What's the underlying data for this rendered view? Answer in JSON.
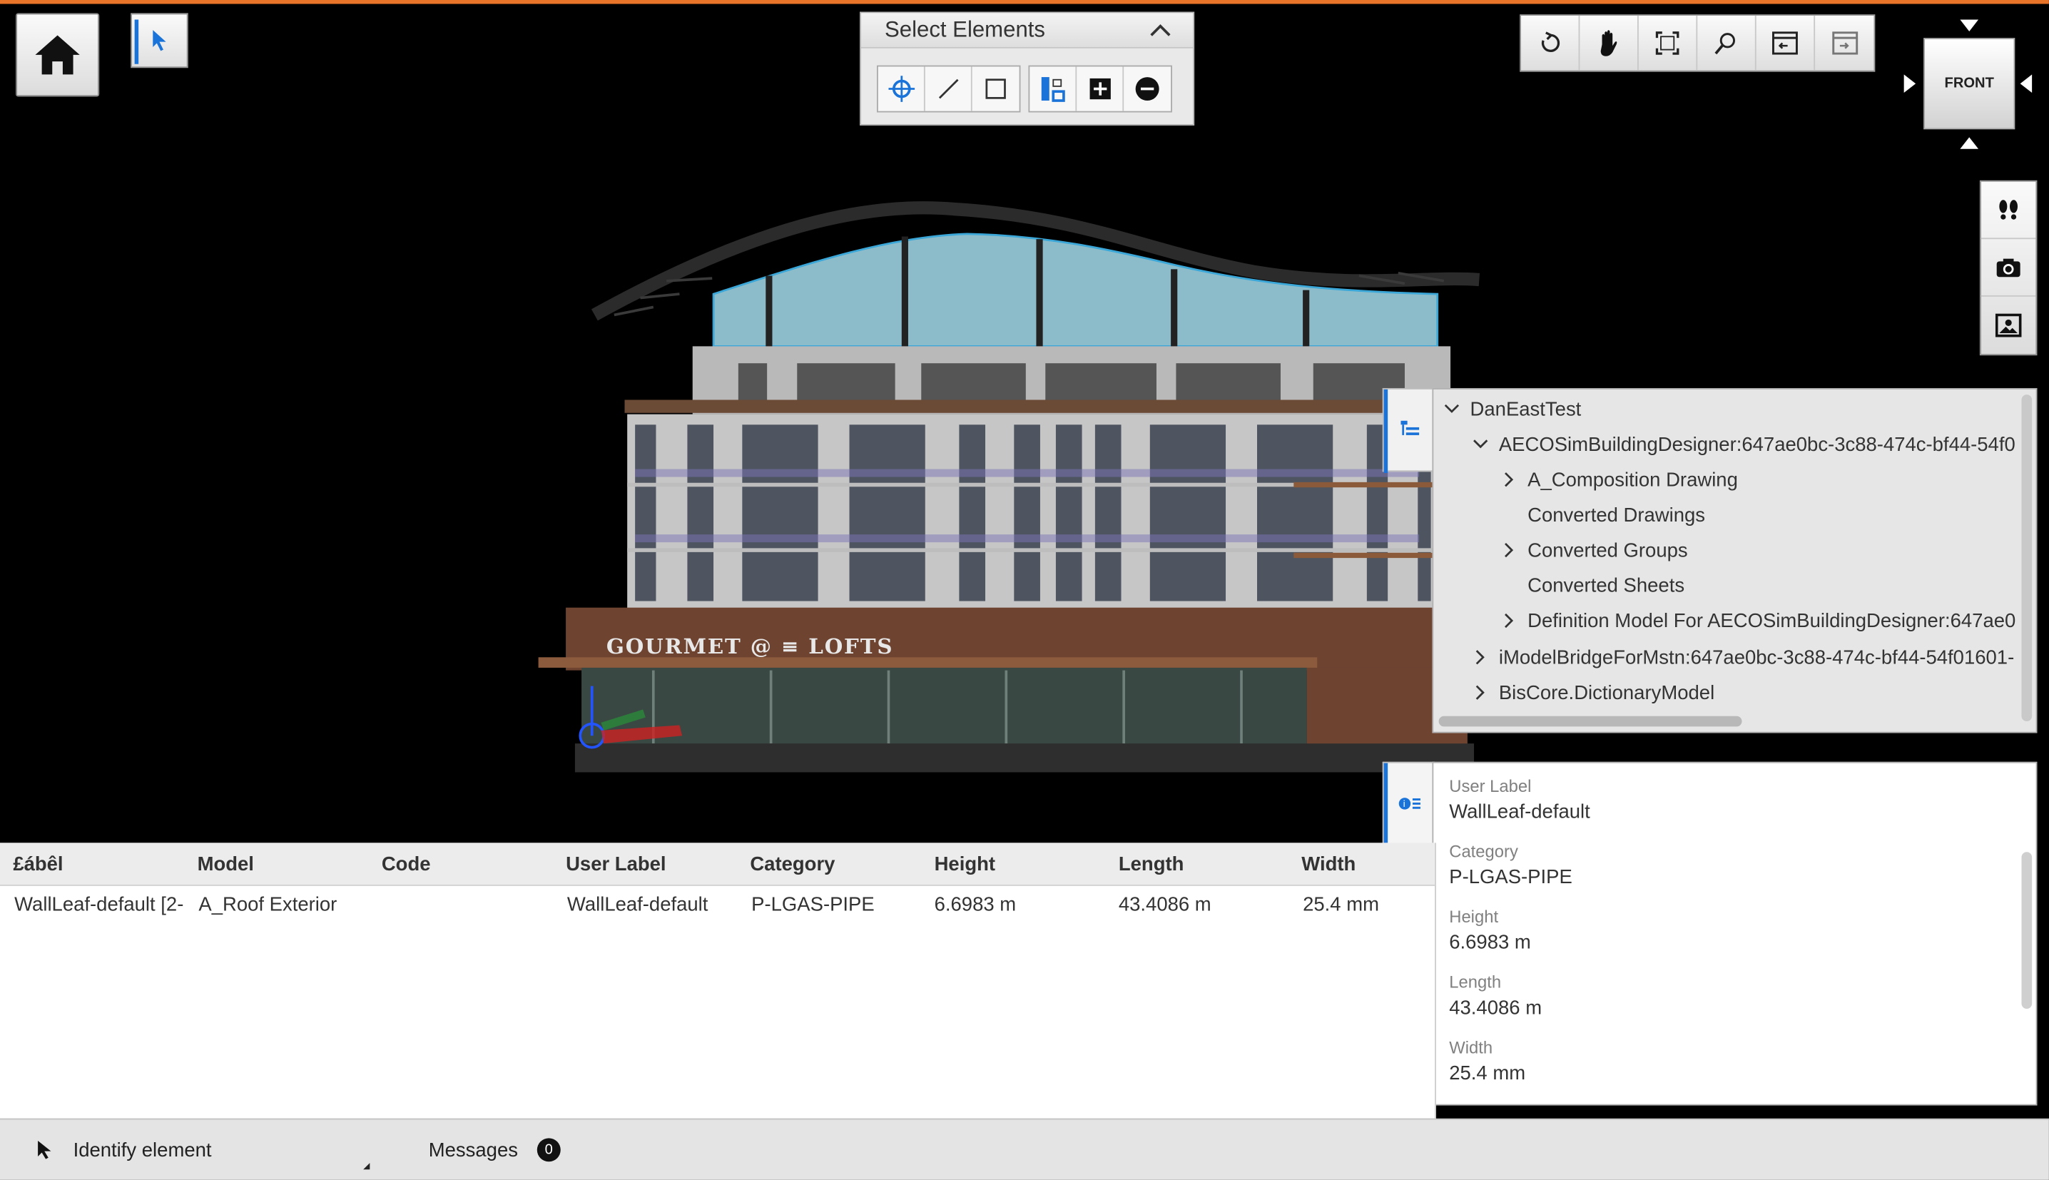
{
  "select_panel": {
    "title": "Select Elements"
  },
  "navigation_cube": {
    "face": "FRONT"
  },
  "model_tree": {
    "items": [
      {
        "label": "DanEastTest",
        "expanded": true
      },
      {
        "label": "AECOSimBuildingDesigner:647ae0bc-3c88-474c-bf44-54f0",
        "expanded": true
      },
      {
        "label": "A_Composition Drawing",
        "expanded": false
      },
      {
        "label": "Converted Drawings"
      },
      {
        "label": "Converted Groups",
        "expanded": false
      },
      {
        "label": "Converted Sheets"
      },
      {
        "label": "Definition Model For AECOSimBuildingDesigner:647ae0",
        "expanded": false
      },
      {
        "label": "iModelBridgeForMstn:647ae0bc-3c88-474c-bf44-54f01601-",
        "expanded": false
      },
      {
        "label": "BisCore.DictionaryModel",
        "expanded": false
      }
    ]
  },
  "table": {
    "columns": [
      "£ábêl",
      "Model",
      "Code",
      "User Label",
      "Category",
      "Height",
      "Length",
      "Width"
    ],
    "rows": [
      [
        "WallLeaf-default [2-",
        "A_Roof Exterior",
        "",
        "WallLeaf-default",
        "P-LGAS-PIPE",
        "6.6983 m",
        "43.4086 m",
        "25.4 mm"
      ]
    ]
  },
  "properties": {
    "items": [
      {
        "label": "User Label",
        "value": "WallLeaf-default"
      },
      {
        "label": "Category",
        "value": "P-LGAS-PIPE"
      },
      {
        "label": "Height",
        "value": "6.6983 m"
      },
      {
        "label": "Length",
        "value": "43.4086 m"
      },
      {
        "label": "Width",
        "value": "25.4 mm"
      }
    ]
  },
  "statusbar": {
    "tool_prompt": "Identify element",
    "messages_label": "Messages",
    "messages_count": "0"
  },
  "colors": {
    "accent": "#1a73d9",
    "top_line": "#e8742a"
  }
}
